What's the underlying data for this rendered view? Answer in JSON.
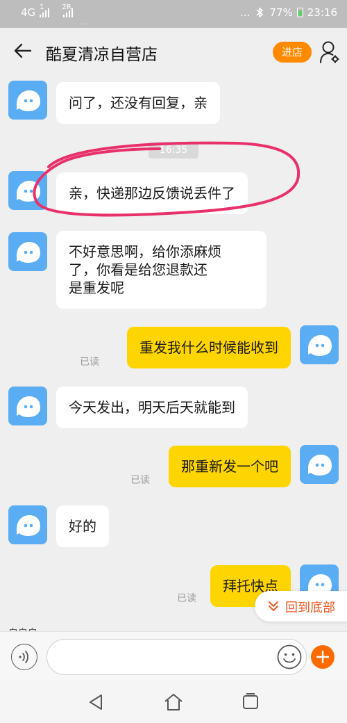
{
  "status_bar": {
    "network": "4G",
    "sim1_badge": "1",
    "sim2_label": "2R",
    "notification_dots": "...",
    "more": "...",
    "battery": "77%",
    "time": "23:16"
  },
  "header": {
    "title": "酷夏清凉自营店",
    "enter_store": "进店"
  },
  "timestamp": "16:35",
  "messages": [
    {
      "side": "left",
      "text": "问了，还没有回复，亲"
    },
    {
      "side": "left",
      "text": "亲，快递那边反馈说丢件了"
    },
    {
      "side": "left",
      "lines": [
        "不好意思啊，给你添麻烦",
        "了，你看是给您退款还",
        "是重发呢"
      ]
    },
    {
      "side": "right",
      "text": "重发我什么时候能收到",
      "status": "已读"
    },
    {
      "side": "left",
      "text": "今天发出，明天后天就能到"
    },
    {
      "side": "right",
      "text": "那重新发一个吧",
      "status": "已读"
    },
    {
      "side": "left",
      "text": "好的"
    },
    {
      "side": "right",
      "text": "拜托快点",
      "status": "已读"
    }
  ],
  "partial_text": "白白白",
  "scroll_to_bottom": "回到底部",
  "input": {
    "value": "",
    "placeholder": ""
  },
  "colors": {
    "accent": "#ff8a00",
    "plus_button": "#ff6a00",
    "scroll_label": "#f05a22",
    "my_bubble": "#ffd500",
    "their_bubble": "#ffffff",
    "avatar": "#5aadf2",
    "annotation": "#e8306a"
  },
  "icons": {
    "back": "arrow-left-icon",
    "profile": "person-settings-icon",
    "voice": "voice-icon",
    "emoji": "smiley-icon",
    "plus": "plus-icon",
    "chevron": "double-chevron-down-icon",
    "nav_back": "triangle-back-icon",
    "nav_home": "house-icon",
    "nav_recent": "square-icon"
  }
}
